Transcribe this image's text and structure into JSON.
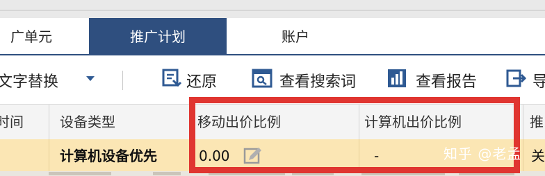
{
  "tabs": [
    {
      "label": "广单元"
    },
    {
      "label": "推广计划",
      "active": true
    },
    {
      "label": "账户"
    }
  ],
  "toolbar": {
    "text_replace_label": "文字替换",
    "restore_label": "还原",
    "view_search_terms_label": "查看搜索词",
    "view_report_label": "查看报告",
    "export_label": "导"
  },
  "table": {
    "columns": [
      "时间",
      "设备类型",
      "移动出价比例",
      "计算机出价比例",
      "推"
    ],
    "row": {
      "device_type": "计算机设备优先",
      "mobile_bid_ratio": "0.00",
      "computer_bid_ratio": "-",
      "last_partial": "关"
    }
  },
  "watermark": "知乎 @老孟",
  "colors": {
    "accent": "#2f4f7f",
    "highlight_row": "#fbe6b4",
    "red_box": "#e03530",
    "icon_blue": "#2f5a93"
  },
  "icons": [
    "caret-down-icon",
    "restore-icon",
    "search-terms-icon",
    "bar-chart-icon",
    "export-icon",
    "edit-icon"
  ]
}
